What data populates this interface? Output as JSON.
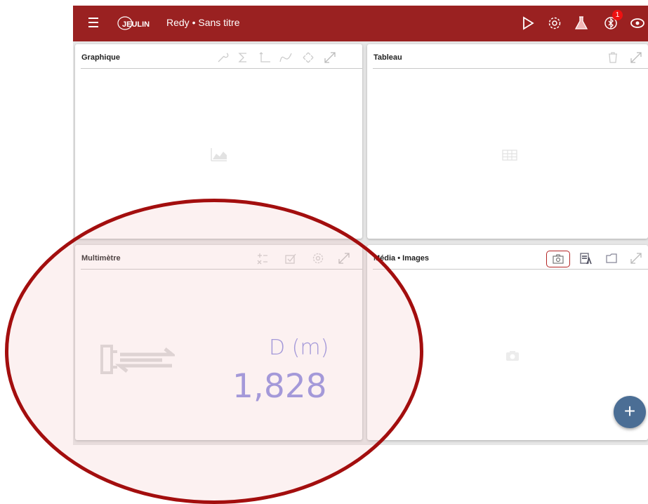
{
  "topbar": {
    "app_title": "Redy • Sans titre",
    "brand": "JEULIN",
    "bluetooth_badge": "1",
    "icons": [
      "menu-icon",
      "play-icon",
      "gear-icon",
      "flask-icon",
      "bluetooth-icon",
      "eye-icon"
    ]
  },
  "panels": {
    "graph": {
      "title": "Graphique",
      "icons": [
        "wrench-icon",
        "sigma-icon",
        "axes-icon",
        "curve-icon",
        "move-icon",
        "expand-icon"
      ]
    },
    "table": {
      "title": "Tableau",
      "icons": [
        "trash-icon",
        "expand-icon"
      ]
    },
    "multimeter": {
      "title": "Multimètre",
      "quantity": "D (m)",
      "value": "1,828",
      "icons": [
        "formula-icon",
        "check-icon",
        "gear-icon",
        "expand-icon"
      ]
    },
    "media": {
      "title": "Média • Images",
      "icons": [
        "camera-icon",
        "text-icon",
        "folder-icon",
        "expand-icon"
      ]
    }
  },
  "fab": {
    "label": "+"
  },
  "colors": {
    "topbar": "#9a2121",
    "accent": "#8f8fe0",
    "fab": "#4b6e95",
    "annotation": "#a30e0e"
  }
}
